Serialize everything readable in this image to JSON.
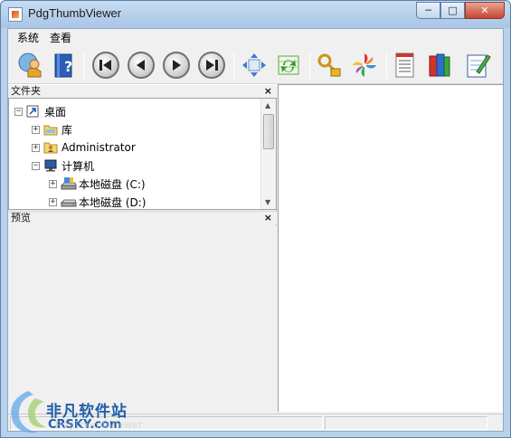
{
  "window": {
    "title": "PdgThumbViewer",
    "minimize_glyph": "─",
    "maximize_glyph": "□",
    "close_glyph": "✕"
  },
  "menu": {
    "items": [
      "系统",
      "查看"
    ]
  },
  "toolbar": {
    "buttons": [
      {
        "name": "user-icon"
      },
      {
        "name": "help-book-icon"
      },
      {
        "name": "first-page-icon"
      },
      {
        "name": "previous-page-icon"
      },
      {
        "name": "next-page-icon"
      },
      {
        "name": "last-page-icon"
      },
      {
        "name": "fit-page-icon"
      },
      {
        "name": "refresh-icon"
      },
      {
        "name": "key-lock-icon"
      },
      {
        "name": "pinwheel-icon"
      },
      {
        "name": "document-list-icon"
      },
      {
        "name": "books-icon"
      },
      {
        "name": "edit-notes-icon"
      }
    ]
  },
  "folders_pane": {
    "title": "文件夹",
    "close_glyph": "×",
    "tree": [
      {
        "label": "桌面",
        "expander": "−",
        "level": 0
      },
      {
        "label": "库",
        "expander": "+",
        "level": 1
      },
      {
        "label": "Administrator",
        "expander": "+",
        "level": 1
      },
      {
        "label": "计算机",
        "expander": "−",
        "level": 1
      },
      {
        "label": "本地磁盘 (C:)",
        "expander": "+",
        "level": 2
      },
      {
        "label": "本地磁盘 (D:)",
        "expander": "+",
        "level": 2
      }
    ]
  },
  "preview_pane": {
    "title": "预览",
    "close_glyph": "×"
  },
  "watermark": {
    "brand_cn": "非凡软件站",
    "brand_en": "CRSKY.com",
    "faint_text": "PdgThumbViewer"
  },
  "colors": {
    "titlebar": "#b9d1ea",
    "panel": "#f0f0f0",
    "content": "#ffffff",
    "watermark_blue": "#1f5fa8"
  }
}
